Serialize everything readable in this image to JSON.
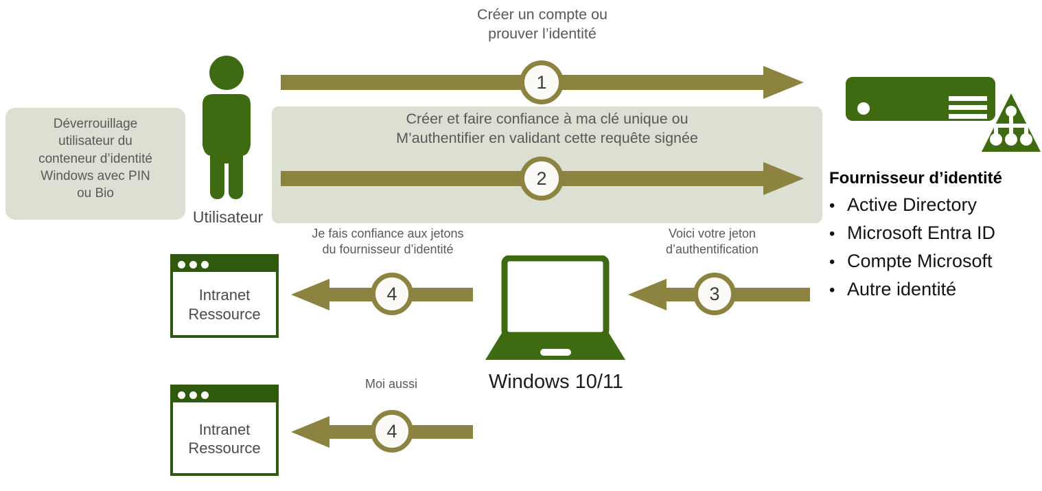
{
  "diagram": {
    "title": "Windows Hello identity provisioning and authentication flow",
    "colors": {
      "green": "#3e6b12",
      "green_dark": "#2f5a0e",
      "olive": "#8c8341",
      "sage": "#dbe0d3",
      "badge_fill": "#fbfaf6",
      "body_text": "#585858",
      "heading_text": "#000000"
    }
  },
  "left_panel": {
    "text": "Déverrouillage\nutilisateur du\nconteneur d’identité\nWindows avec PIN\nou Bio"
  },
  "user": {
    "icon": "person-icon",
    "label": "Utilisateur"
  },
  "identity_provider": {
    "icon": "server-icon",
    "title": "Fournisseur d’identité",
    "bullet": "•",
    "items": [
      "Active Directory",
      "Microsoft Entra ID",
      "Compte Microsoft",
      "Autre identité"
    ]
  },
  "device": {
    "icon": "laptop-icon",
    "label": "Windows 10/11"
  },
  "resources": [
    {
      "label": "Intranet\nRessource"
    },
    {
      "label": "Intranet\nRessource"
    }
  ],
  "steps": [
    {
      "number": "1",
      "label": "Créer un compte ou\nprouver l’identité",
      "direction": "right"
    },
    {
      "number": "2",
      "label": "Créer et faire confiance à ma clé unique ou\nM’authentifier en validant cette requête signée",
      "direction": "right"
    },
    {
      "number": "3",
      "label": "Voici votre jeton\nd’authentification",
      "direction": "left"
    },
    {
      "number": "4",
      "label": "Je fais confiance aux jetons\ndu fournisseur d’identité",
      "direction": "left"
    },
    {
      "number": "4",
      "label": "Moi aussi",
      "direction": "left"
    }
  ]
}
